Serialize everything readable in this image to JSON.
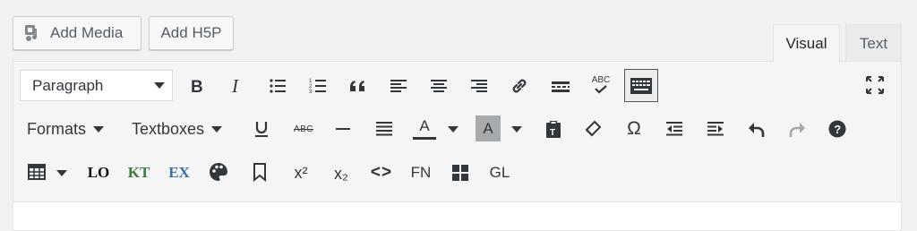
{
  "media_buttons": {
    "add_media": "Add Media",
    "add_h5p": "Add H5P"
  },
  "tabs": {
    "visual": "Visual",
    "text": "Text",
    "active": "visual"
  },
  "toolbar": {
    "format_select_value": "Paragraph",
    "formats_label": "Formats",
    "textboxes_label": "Textboxes",
    "strikethrough_label": "ABC",
    "spellcheck_label": "ABC",
    "text_color_label": "A",
    "background_color_label": "A",
    "special_char_label": "Ω",
    "lo_label": "LO",
    "kt_label": "KT",
    "ex_label": "EX",
    "superscript_label": "x²",
    "subscript_label": "x₂",
    "code_label": "<>",
    "fn_label": "FN",
    "gl_label": "GL"
  },
  "colors": {
    "kt": "#3d7a3d",
    "ex": "#3a6ea5",
    "redo_disabled": "#a7aaad"
  }
}
